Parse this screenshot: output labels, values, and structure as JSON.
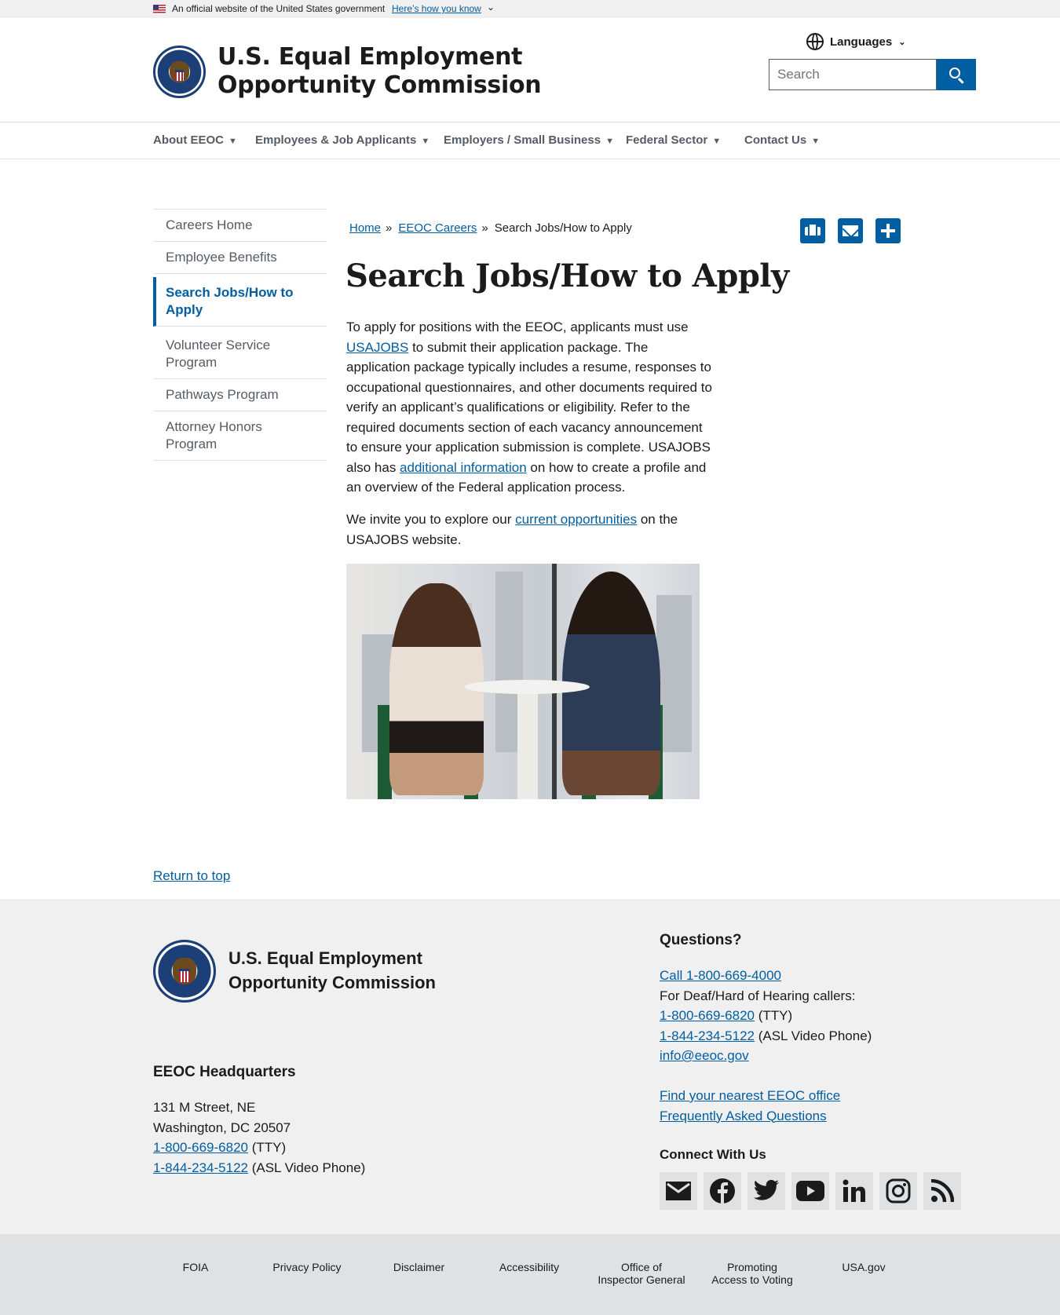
{
  "gov_banner": {
    "official_text": "An official website of the United States government",
    "how_you_know": "Here’s how you know"
  },
  "header": {
    "title_line1": "U.S. Equal Employment",
    "title_line2": "Opportunity Commission",
    "languages_label": "Languages",
    "search_placeholder": "Search"
  },
  "nav": {
    "items": [
      {
        "label": "About EEOC"
      },
      {
        "label": "Employees & Job Applicants"
      },
      {
        "label": "Employers / Small Business"
      },
      {
        "label": "Federal Sector"
      },
      {
        "label": "Contact Us"
      }
    ]
  },
  "sidenav": {
    "items": [
      {
        "label": "Careers Home"
      },
      {
        "label": "Employee Benefits"
      },
      {
        "label": "Search Jobs/How to Apply"
      },
      {
        "label": "Volunteer Service Program"
      },
      {
        "label": "Pathways Program"
      },
      {
        "label": "Attorney Honors Program"
      }
    ]
  },
  "breadcrumb": {
    "home": "Home",
    "careers": "EEOC Careers",
    "separator": "»",
    "current": "Search Jobs/How to Apply"
  },
  "page": {
    "title": "Search Jobs/How to Apply",
    "p1_a": "To apply for positions with the EEOC, applicants must use ",
    "p1_link1": "USAJOBS",
    "p1_b": " to submit their application package. The application package typically includes a resume, responses to occupational questionnaires, and other documents required to verify an applicant’s qualifications or eligibility. Refer to the required documents section of each vacancy announcement to ensure your application submission is complete. USAJOBS also has ",
    "p1_link2": "additional information",
    "p1_c": " on how to create a profile and an overview of the Federal application process.",
    "p2_a": "We invite you to explore our ",
    "p2_link": "current opportunities",
    "p2_b": " on the USAJOBS website.",
    "return_top": "Return to top"
  },
  "footer": {
    "title_line1": "U.S. Equal Employment",
    "title_line2": "Opportunity Commission",
    "hq_heading": "EEOC Headquarters",
    "hq_street": "131 M Street, NE",
    "hq_city": "Washington, DC 20507",
    "hq_tty_number": "1-800-669-6820",
    "hq_tty_suffix": "(TTY)",
    "hq_asl_number": "1-844-234-5122",
    "hq_asl_suffix": "(ASL Video Phone)",
    "questions_heading": "Questions?",
    "call_link": "Call 1-800-669-4000",
    "deaf_text": "For Deaf/Hard of Hearing callers:",
    "q_tty_number": "1-800-669-6820",
    "q_tty_suffix": "(TTY)",
    "q_asl_number": "1-844-234-5122",
    "q_asl_suffix": "(ASL Video Phone)",
    "email": "info@eeoc.gov",
    "nearest_office": "Find your nearest EEOC office",
    "faq": "Frequently Asked Questions",
    "connect_heading": "Connect With Us",
    "social_icons": [
      "email-icon",
      "facebook-icon",
      "twitter-icon",
      "youtube-icon",
      "linkedin-icon",
      "instagram-icon",
      "rss-icon"
    ]
  },
  "bottom_links": [
    {
      "label": "FOIA"
    },
    {
      "label": "Privacy Policy"
    },
    {
      "label": "Disclaimer"
    },
    {
      "label": "Accessibility"
    },
    {
      "label": "Office of\nInspector General"
    },
    {
      "label": "Promoting\nAccess to Voting"
    },
    {
      "label": "USA.gov"
    }
  ],
  "colors": {
    "link_blue": "#005ea2",
    "banner_gray": "#f0f0f0",
    "bottom_gray": "#dfe1e2",
    "nav_text": "#565c65"
  }
}
